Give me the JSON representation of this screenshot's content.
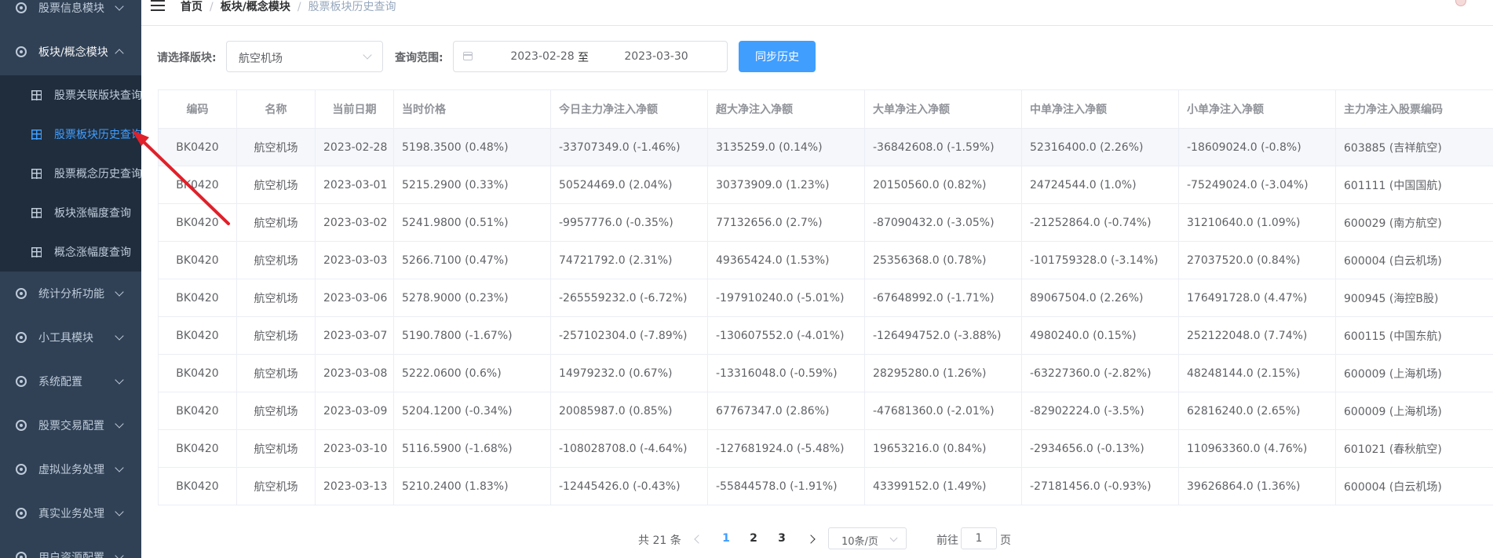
{
  "sidebar": {
    "top_items": [
      {
        "label": "股票信息模块"
      },
      {
        "label": "板块/概念模块"
      }
    ],
    "sub_items": [
      {
        "label": "股票关联版块查询"
      },
      {
        "label": "股票板块历史查询"
      },
      {
        "label": "股票概念历史查询"
      },
      {
        "label": "板块涨幅度查询"
      },
      {
        "label": "概念涨幅度查询"
      }
    ],
    "bottom_items": [
      {
        "label": "统计分析功能"
      },
      {
        "label": "小工具模块"
      },
      {
        "label": "系统配置"
      },
      {
        "label": "股票交易配置"
      },
      {
        "label": "虚拟业务处理"
      },
      {
        "label": "真实业务处理"
      },
      {
        "label": "用户资源配置"
      }
    ]
  },
  "breadcrumb": {
    "home": "首页",
    "section": "板块/概念模块",
    "current": "股票板块历史查询",
    "separator": "/"
  },
  "form": {
    "board_label": "请选择版块:",
    "board_value": "航空机场",
    "range_label": "查询范围:",
    "start_date": "2023-02-28",
    "range_separator": "至",
    "end_date": "2023-03-30",
    "sync_button": "同步历史"
  },
  "table": {
    "headers": [
      "编码",
      "名称",
      "当前日期",
      "当时价格",
      "今日主力净注入净额",
      "超大净注入净额",
      "大单净注入净额",
      "中单净注入净额",
      "小单净注入净额",
      "主力净注入股票编码"
    ],
    "rows": [
      [
        "BK0420",
        "航空机场",
        "2023-02-28",
        "5198.3500 (0.48%)",
        "-33707349.0 (-1.46%)",
        "3135259.0 (0.14%)",
        "-36842608.0 (-1.59%)",
        "52316400.0 (2.26%)",
        "-18609024.0 (-0.8%)",
        "603885 (吉祥航空)"
      ],
      [
        "BK0420",
        "航空机场",
        "2023-03-01",
        "5215.2900 (0.33%)",
        "50524469.0 (2.04%)",
        "30373909.0 (1.23%)",
        "20150560.0 (0.82%)",
        "24724544.0 (1.0%)",
        "-75249024.0 (-3.04%)",
        "601111 (中国国航)"
      ],
      [
        "BK0420",
        "航空机场",
        "2023-03-02",
        "5241.9800 (0.51%)",
        "-9957776.0 (-0.35%)",
        "77132656.0 (2.7%)",
        "-87090432.0 (-3.05%)",
        "-21252864.0 (-0.74%)",
        "31210640.0 (1.09%)",
        "600029 (南方航空)"
      ],
      [
        "BK0420",
        "航空机场",
        "2023-03-03",
        "5266.7100 (0.47%)",
        "74721792.0 (2.31%)",
        "49365424.0 (1.53%)",
        "25356368.0 (0.78%)",
        "-101759328.0 (-3.14%)",
        "27037520.0 (0.84%)",
        "600004 (白云机场)"
      ],
      [
        "BK0420",
        "航空机场",
        "2023-03-06",
        "5278.9000 (0.23%)",
        "-265559232.0 (-6.72%)",
        "-197910240.0 (-5.01%)",
        "-67648992.0 (-1.71%)",
        "89067504.0 (2.26%)",
        "176491728.0 (4.47%)",
        "900945 (海控B股)"
      ],
      [
        "BK0420",
        "航空机场",
        "2023-03-07",
        "5190.7800 (-1.67%)",
        "-257102304.0 (-7.89%)",
        "-130607552.0 (-4.01%)",
        "-126494752.0 (-3.88%)",
        "4980240.0 (0.15%)",
        "252122048.0 (7.74%)",
        "600115 (中国东航)"
      ],
      [
        "BK0420",
        "航空机场",
        "2023-03-08",
        "5222.0600 (0.6%)",
        "14979232.0 (0.67%)",
        "-13316048.0 (-0.59%)",
        "28295280.0 (1.26%)",
        "-63227360.0 (-2.82%)",
        "48248144.0 (2.15%)",
        "600009 (上海机场)"
      ],
      [
        "BK0420",
        "航空机场",
        "2023-03-09",
        "5204.1200 (-0.34%)",
        "20085987.0 (0.85%)",
        "67767347.0 (2.86%)",
        "-47681360.0 (-2.01%)",
        "-82902224.0 (-3.5%)",
        "62816240.0 (2.65%)",
        "600009 (上海机场)"
      ],
      [
        "BK0420",
        "航空机场",
        "2023-03-10",
        "5116.5900 (-1.68%)",
        "-108028708.0 (-4.64%)",
        "-127681924.0 (-5.48%)",
        "19653216.0 (0.84%)",
        "-2934656.0 (-0.13%)",
        "110963360.0 (4.76%)",
        "601021 (春秋航空)"
      ],
      [
        "BK0420",
        "航空机场",
        "2023-03-13",
        "5210.2400 (1.83%)",
        "-12445426.0 (-0.43%)",
        "-55844578.0 (-1.91%)",
        "43399152.0 (1.49%)",
        "-27181456.0 (-0.93%)",
        "39626864.0 (1.36%)",
        "600004 (白云机场)"
      ]
    ]
  },
  "pagination": {
    "total": "共 21 条",
    "pages": [
      "1",
      "2",
      "3"
    ],
    "current_page": "1",
    "page_size": "10条/页",
    "goto_label": "前往",
    "goto_value": "1",
    "goto_suffix": "页"
  },
  "colors": {
    "sidebar_bg": "#304156",
    "submenu_bg": "#1f2d3d",
    "accent": "#409eff",
    "annotation": "#e0202a"
  },
  "icons": {
    "menu_toggle": "hamburger-icon",
    "menu_group": "target-circle-icon",
    "sub_item": "grid-icon",
    "date": "calendar-icon"
  }
}
